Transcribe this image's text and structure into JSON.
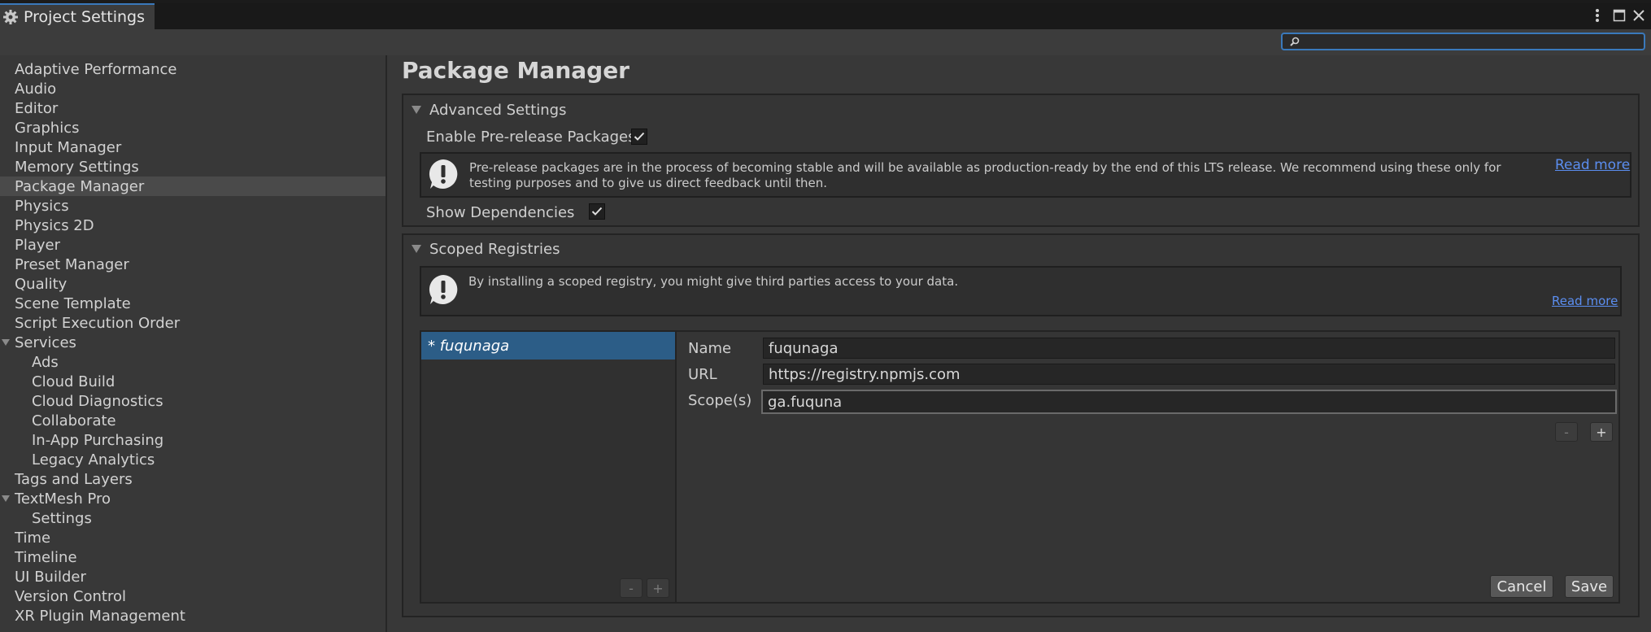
{
  "window": {
    "title": "Project Settings"
  },
  "search": {
    "value": "",
    "placeholder": ""
  },
  "sidebar": {
    "items": [
      {
        "label": "Adaptive Performance",
        "indent": 0
      },
      {
        "label": "Audio",
        "indent": 0
      },
      {
        "label": "Editor",
        "indent": 0
      },
      {
        "label": "Graphics",
        "indent": 0
      },
      {
        "label": "Input Manager",
        "indent": 0
      },
      {
        "label": "Memory Settings",
        "indent": 0
      },
      {
        "label": "Package Manager",
        "indent": 0,
        "selected": true
      },
      {
        "label": "Physics",
        "indent": 0
      },
      {
        "label": "Physics 2D",
        "indent": 0
      },
      {
        "label": "Player",
        "indent": 0
      },
      {
        "label": "Preset Manager",
        "indent": 0
      },
      {
        "label": "Quality",
        "indent": 0
      },
      {
        "label": "Scene Template",
        "indent": 0
      },
      {
        "label": "Script Execution Order",
        "indent": 0
      },
      {
        "label": "Services",
        "indent": 0,
        "foldout": true
      },
      {
        "label": "Ads",
        "indent": 1
      },
      {
        "label": "Cloud Build",
        "indent": 1
      },
      {
        "label": "Cloud Diagnostics",
        "indent": 1
      },
      {
        "label": "Collaborate",
        "indent": 1
      },
      {
        "label": "In-App Purchasing",
        "indent": 1
      },
      {
        "label": "Legacy Analytics",
        "indent": 1
      },
      {
        "label": "Tags and Layers",
        "indent": 0
      },
      {
        "label": "TextMesh Pro",
        "indent": 0,
        "foldout": true
      },
      {
        "label": "Settings",
        "indent": 1
      },
      {
        "label": "Time",
        "indent": 0
      },
      {
        "label": "Timeline",
        "indent": 0
      },
      {
        "label": "UI Builder",
        "indent": 0
      },
      {
        "label": "Version Control",
        "indent": 0
      },
      {
        "label": "XR Plugin Management",
        "indent": 0
      }
    ]
  },
  "page": {
    "title": "Package Manager",
    "advanced": {
      "header": "Advanced Settings",
      "prerelease_label": "Enable Pre-release Packages",
      "prerelease_checked": true,
      "info_text": "Pre-release packages are in the process of becoming stable and will be available as production-ready by the end of this LTS release. We recommend using these only for testing purposes and to give us direct feedback until then.",
      "read_more": "Read more",
      "dependencies_label": "Show Dependencies",
      "dependencies_checked": true
    },
    "scoped": {
      "header": "Scoped Registries",
      "warning_text": "By installing a scoped registry, you might give third parties access to your data.",
      "read_more": "Read more",
      "registries": [
        "* fuqunaga"
      ],
      "list_minus": "-",
      "list_plus": "+",
      "name_label": "Name",
      "name_value": "fuqunaga",
      "url_label": "URL",
      "url_value": "https://registry.npmjs.com",
      "scope_label": "Scope(s)",
      "scope_value": "ga.fuquna",
      "scope_minus": "-",
      "scope_plus": "+",
      "cancel_label": "Cancel",
      "save_label": "Save"
    }
  }
}
